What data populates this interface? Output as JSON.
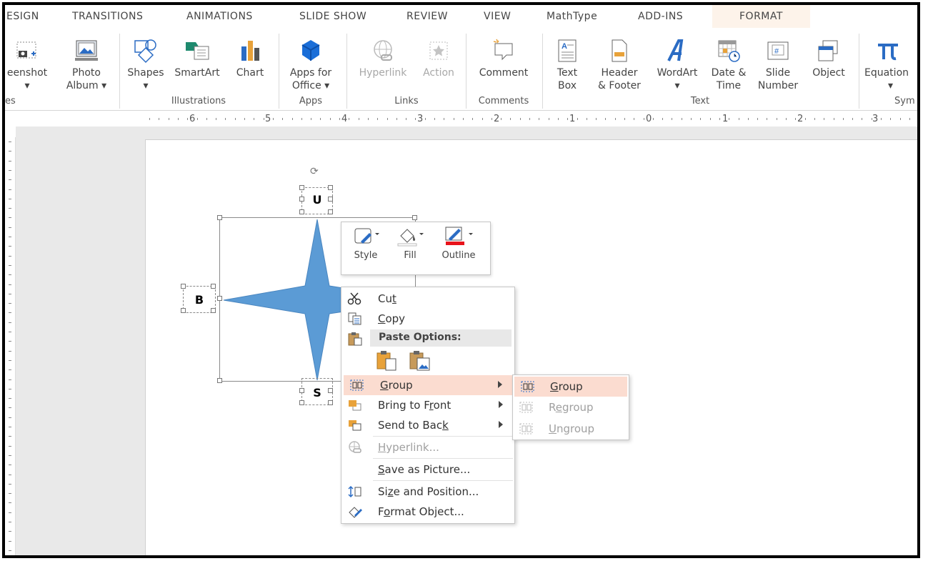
{
  "tabs": [
    "ESIGN",
    "TRANSITIONS",
    "ANIMATIONS",
    "SLIDE SHOW",
    "REVIEW",
    "VIEW",
    "MathType",
    "ADD-INS",
    "FORMAT"
  ],
  "ribbon": {
    "screenshot": {
      "line1": "eenshot",
      "line2": "▾"
    },
    "photo_album": {
      "line1": "Photo",
      "line2": "Album ▾"
    },
    "shapes": {
      "line1": "Shapes",
      "line2": "▾"
    },
    "smartart": {
      "line1": "SmartArt"
    },
    "chart": {
      "line1": "Chart"
    },
    "apps_for_office": {
      "line1": "Apps for",
      "line2": "Office ▾"
    },
    "hyperlink": {
      "line1": "Hyperlink"
    },
    "action": {
      "line1": "Action"
    },
    "comment": {
      "line1": "Comment"
    },
    "text_box": {
      "line1": "Text",
      "line2": "Box"
    },
    "header_footer": {
      "line1": "Header",
      "line2": "& Footer"
    },
    "wordart": {
      "line1": "WordArt",
      "line2": "▾"
    },
    "date_time": {
      "line1": "Date &",
      "line2": "Time"
    },
    "slide_number": {
      "line1": "Slide",
      "line2": "Number"
    },
    "object": {
      "line1": "Object"
    },
    "equation": {
      "line1": "Equation",
      "line2": "▾"
    },
    "groups": {
      "images": "es",
      "illustrations": "Illustrations",
      "apps": "Apps",
      "links": "Links",
      "comments": "Comments",
      "text": "Text",
      "symbols": "Sym"
    }
  },
  "ruler_numbers": [
    "6",
    "5",
    "4",
    "3",
    "2",
    "1",
    "0",
    "1",
    "2",
    "3"
  ],
  "slide": {
    "letter_top": "U",
    "letter_left": "B",
    "letter_bottom": "S"
  },
  "mini_toolbar": {
    "style": "Style",
    "fill": "Fill",
    "outline": "Outline"
  },
  "context_menu": {
    "cut": {
      "pre": "Cu",
      "key": "t",
      "post": ""
    },
    "copy": {
      "pre": "",
      "key": "C",
      "post": "opy"
    },
    "paste_options": "Paste Options:",
    "group": {
      "pre": "",
      "key": "G",
      "post": "roup"
    },
    "bring_to_front": {
      "pre": "Bring to F",
      "key": "r",
      "post": "ont"
    },
    "send_to_back": {
      "pre": "Send to Bac",
      "key": "k",
      "post": ""
    },
    "hyperlink": {
      "pre": "",
      "key": "H",
      "post": "yperlink..."
    },
    "save_as_picture": {
      "pre": "",
      "key": "S",
      "post": "ave as Picture..."
    },
    "size_and_position": {
      "pre": "Si",
      "key": "z",
      "post": "e and Position..."
    },
    "format_object": {
      "pre": "F",
      "key": "o",
      "post": "rmat Object..."
    }
  },
  "submenu": {
    "group": {
      "pre": "",
      "key": "G",
      "post": "roup"
    },
    "regroup": {
      "pre": "R",
      "key": "e",
      "post": "group"
    },
    "ungroup": {
      "pre": "",
      "key": "U",
      "post": "ngroup"
    }
  },
  "colors": {
    "shape_fill": "#5b9bd5",
    "highlight": "#fbdcd0",
    "format_tab_bg": "#fdf3ea",
    "outline_red": "#e8131b",
    "icon_blue": "#2b6cc4"
  }
}
